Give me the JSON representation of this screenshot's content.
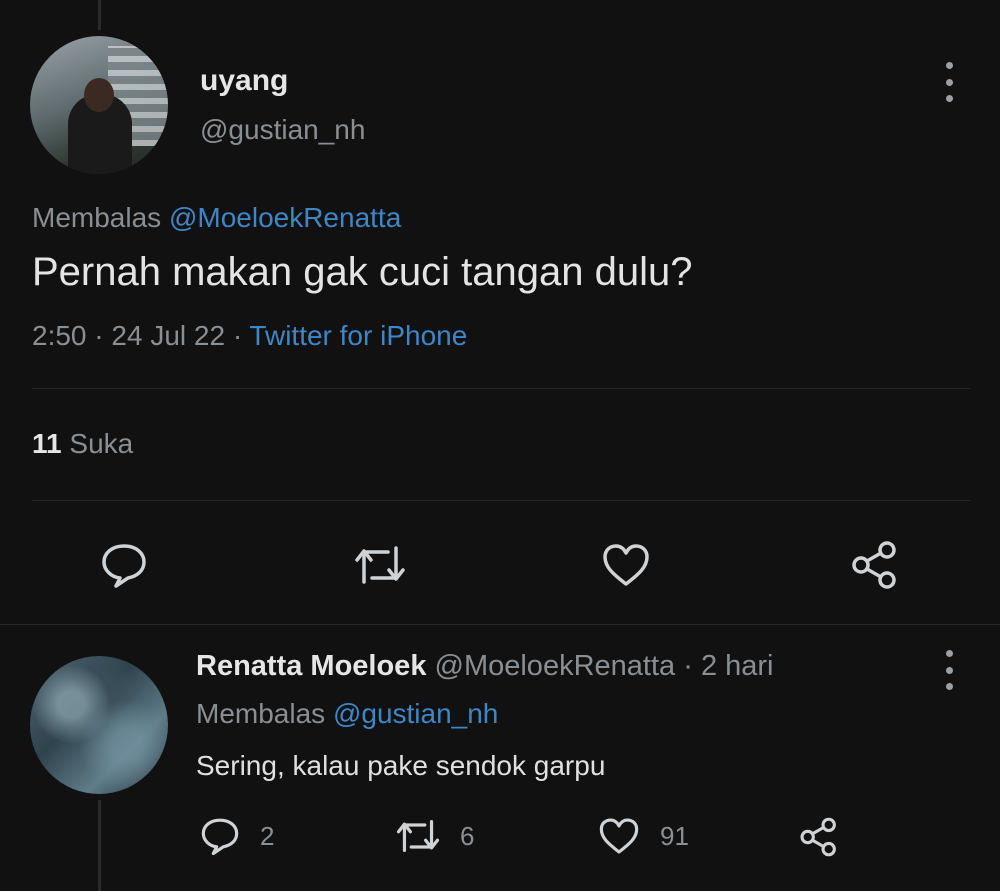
{
  "tweet": {
    "display_name": "uyang",
    "handle": "@gustian_nh",
    "replying_prefix": "Membalas",
    "replying_to": "@MoeloekRenatta",
    "text": "Pernah makan gak cuci tangan dulu?",
    "time": "2:50",
    "date": "24 Jul 22",
    "source": "Twitter for iPhone",
    "separator": "·",
    "likes_count": "11",
    "likes_label": "Suka"
  },
  "reply": {
    "display_name": "Renatta Moeloek",
    "handle": "@MoeloekRenatta",
    "age": "2 hari",
    "separator": "·",
    "replying_prefix": "Membalas",
    "replying_to": "@gustian_nh",
    "text": "Sering, kalau pake sendok garpu",
    "reply_count": "2",
    "retweet_count": "6",
    "like_count": "91"
  },
  "icons": [
    "more-vertical-icon",
    "reply-icon",
    "retweet-icon",
    "like-icon",
    "share-icon"
  ],
  "colors": {
    "background": "#111111",
    "link": "#3e86c6",
    "muted": "#8a8f93",
    "text": "#e4e4e4"
  }
}
